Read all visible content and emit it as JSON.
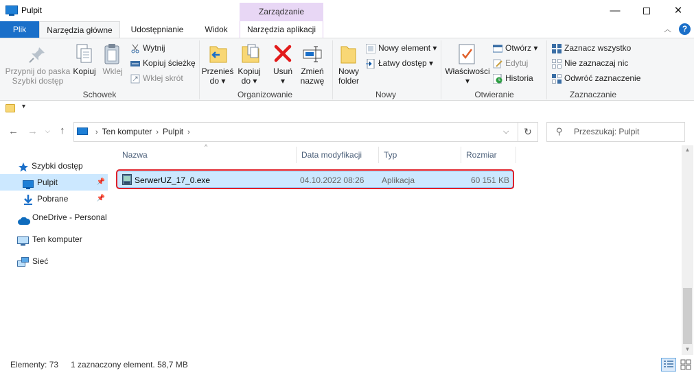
{
  "window": {
    "title": "Pulpit",
    "context_group": "Zarządzanie",
    "minimize": "—",
    "close": "✕"
  },
  "ribbon_tabs": {
    "file": "Plik",
    "home": "Narzędzia główne",
    "share": "Udostępnianie",
    "view": "Widok",
    "app_tools": "Narzędzia aplikacji",
    "collapse": "︿",
    "help": "?"
  },
  "ribbon": {
    "clipboard": {
      "label": "Schowek",
      "pin_line1": "Przypnij do paska",
      "pin_line2": "Szybki dostęp",
      "copy": "Kopiuj",
      "paste": "Wklej",
      "cut": "Wytnij",
      "copy_path": "Kopiuj ścieżkę",
      "paste_shortcut": "Wklej skrót"
    },
    "organize": {
      "label": "Organizowanie",
      "move_line1": "Przenieś",
      "move_line2": "do ▾",
      "copy_line1": "Kopiuj",
      "copy_line2": "do ▾",
      "delete_line1": "Usuń",
      "delete_line2": "▾",
      "rename_line1": "Zmień",
      "rename_line2": "nazwę"
    },
    "new": {
      "label": "Nowy",
      "folder_line1": "Nowy",
      "folder_line2": "folder",
      "new_item": "Nowy element ▾",
      "easy_access": "Łatwy dostęp ▾"
    },
    "open": {
      "label": "Otwieranie",
      "properties": "Właściwości",
      "properties_arrow": "▾",
      "open": "Otwórz ▾",
      "edit": "Edytuj",
      "history": "Historia"
    },
    "select": {
      "label": "Zaznaczanie",
      "select_all": "Zaznacz wszystko",
      "select_none": "Nie zaznaczaj nic",
      "invert": "Odwróć zaznaczenie"
    }
  },
  "qat": {
    "dropdown": "▾"
  },
  "address": {
    "crumbs": [
      "Ten komputer",
      "Pulpit"
    ],
    "chevron": "›",
    "dropdown": "⌵",
    "refresh": "↻",
    "back": "←",
    "forward": "→",
    "recent": "⌵",
    "up": "↑"
  },
  "search": {
    "placeholder": "Przeszukaj: Pulpit",
    "icon_glyph": "⚲"
  },
  "nav_pane": [
    {
      "label": "Szybki dostęp",
      "icon": "star-icon"
    },
    {
      "label": "Pulpit",
      "icon": "desktop-icon",
      "pinned": true,
      "selected": true
    },
    {
      "label": "Pobrane",
      "icon": "download-icon",
      "pinned": true
    },
    {
      "label": "OneDrive - Personal",
      "icon": "cloud-icon"
    },
    {
      "label": "Ten komputer",
      "icon": "computer-icon"
    },
    {
      "label": "Sieć",
      "icon": "network-icon"
    }
  ],
  "columns": {
    "name": "Nazwa",
    "modified": "Data modyfikacji",
    "type": "Typ",
    "size": "Rozmiar",
    "sort_glyph": "^"
  },
  "files": [
    {
      "name": "SerwerUZ_17_0.exe",
      "modified": "04.10.2022 08:26",
      "type": "Aplikacja",
      "size": "60 151 KB"
    }
  ],
  "status": {
    "count": "Elementy: 73",
    "selected": "1 zaznaczony element. 58,7 MB"
  },
  "scroll": {
    "up": "▲",
    "down": "▼"
  },
  "colors": {
    "accent": "#1a6fc9",
    "selection": "#cce8ff",
    "highlight": "#e0202a",
    "context_tab": "#e8d7f5"
  }
}
